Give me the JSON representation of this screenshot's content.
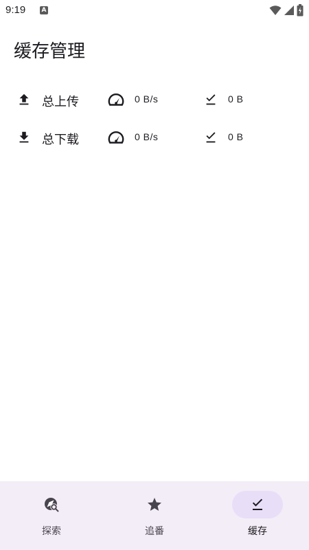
{
  "status_bar": {
    "time": "9:19",
    "notification_icon_text": "A",
    "icons": [
      "wifi-icon",
      "signal-icon",
      "battery-icon"
    ]
  },
  "page": {
    "title": "缓存管理"
  },
  "stats": [
    {
      "direction_icon": "upload-icon",
      "label": "总上传",
      "speed": "0 B/s",
      "total": "0 B"
    },
    {
      "direction_icon": "download-icon",
      "label": "总下载",
      "speed": "0 B/s",
      "total": "0 B"
    }
  ],
  "bottom_nav": {
    "active_index": 2,
    "items": [
      {
        "label": "探索",
        "icon": "explore-search-icon"
      },
      {
        "label": "追番",
        "icon": "star-icon"
      },
      {
        "label": "缓存",
        "icon": "download-done-icon"
      }
    ]
  },
  "colors": {
    "background": "#ffffff",
    "nav_background": "#f3edf7",
    "active_pill": "#e8def8",
    "text": "#1d1b20",
    "nav_label": "#49454f"
  }
}
